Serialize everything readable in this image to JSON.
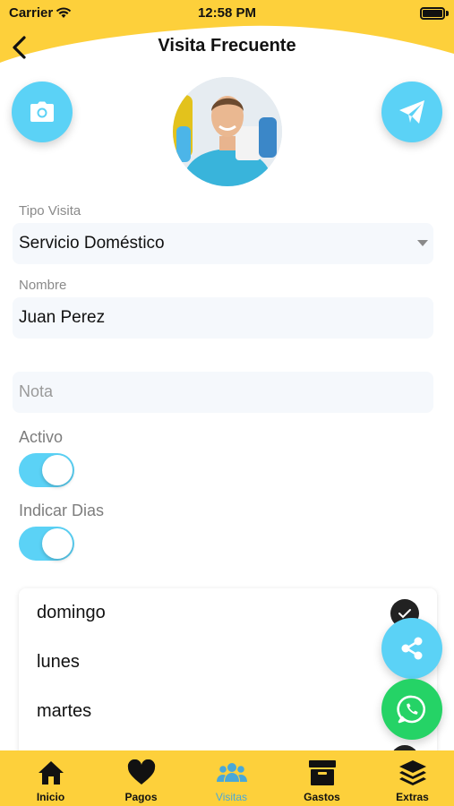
{
  "status_bar": {
    "carrier": "Carrier",
    "time": "12:58 PM"
  },
  "header": {
    "title": "Visita Frecuente"
  },
  "form": {
    "tipo_visita": {
      "label": "Tipo Visita",
      "value": "Servicio Doméstico"
    },
    "nombre": {
      "label": "Nombre",
      "value": "Juan Perez"
    },
    "nota": {
      "placeholder": "Nota"
    },
    "activo": {
      "label": "Activo",
      "on": true
    },
    "indicar_dias": {
      "label": "Indicar Dias",
      "on": true
    }
  },
  "days": [
    {
      "label": "domingo",
      "checked": true
    },
    {
      "label": "lunes",
      "checked": false
    },
    {
      "label": "martes",
      "checked": false
    }
  ],
  "tabs": [
    {
      "label": "Inicio",
      "icon": "home-icon",
      "active": false
    },
    {
      "label": "Pagos",
      "icon": "heart-icon",
      "active": false
    },
    {
      "label": "Visitas",
      "icon": "people-icon",
      "active": true
    },
    {
      "label": "Gastos",
      "icon": "archive-icon",
      "active": false
    },
    {
      "label": "Extras",
      "icon": "layers-icon",
      "active": false
    }
  ],
  "colors": {
    "brand_yellow": "#fdd03b",
    "accent_blue": "#5bd2f6",
    "whatsapp_green": "#25d366",
    "active_tab": "#4aa8d8"
  }
}
